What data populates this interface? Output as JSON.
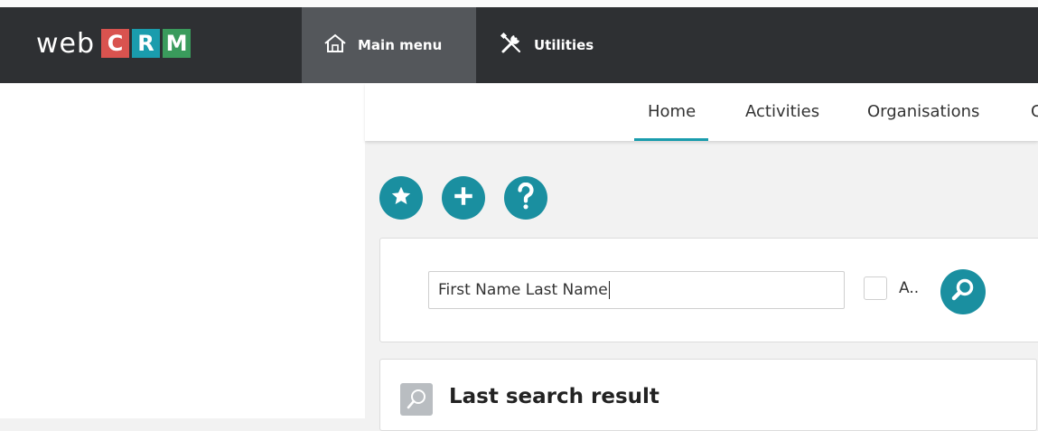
{
  "logo": {
    "text": "web",
    "letters": [
      {
        "char": "C",
        "color": "#d9534f"
      },
      {
        "char": "R",
        "color": "#1a9cad"
      },
      {
        "char": "M",
        "color": "#3a9b5c"
      }
    ]
  },
  "topnav": {
    "main_menu": {
      "label": "Main menu",
      "icon": "home-icon"
    },
    "utilities": {
      "label": "Utilities",
      "icon": "tools-icon"
    }
  },
  "tabs": [
    {
      "label": "Home",
      "active": true
    },
    {
      "label": "Activities",
      "active": false
    },
    {
      "label": "Organisations",
      "active": false
    },
    {
      "label": "C",
      "active": false
    }
  ],
  "actions": [
    {
      "icon": "star-icon"
    },
    {
      "icon": "plus-icon"
    },
    {
      "icon": "question-icon"
    }
  ],
  "search": {
    "value": "First Name Last Name",
    "checkbox_label": "A..",
    "button_icon": "search-icon"
  },
  "last_search": {
    "title": "Last search result",
    "icon": "search-icon"
  },
  "colors": {
    "accent": "#1a8fa0",
    "topbar": "#2e3033",
    "active_nav": "#54575b"
  }
}
